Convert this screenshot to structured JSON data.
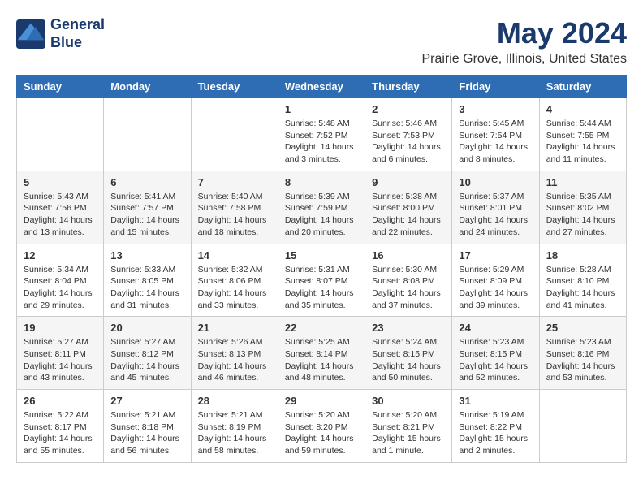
{
  "logo": {
    "line1": "General",
    "line2": "Blue"
  },
  "title": "May 2024",
  "location": "Prairie Grove, Illinois, United States",
  "days_of_week": [
    "Sunday",
    "Monday",
    "Tuesday",
    "Wednesday",
    "Thursday",
    "Friday",
    "Saturday"
  ],
  "weeks": [
    [
      {
        "day": "",
        "text": ""
      },
      {
        "day": "",
        "text": ""
      },
      {
        "day": "",
        "text": ""
      },
      {
        "day": "1",
        "text": "Sunrise: 5:48 AM\nSunset: 7:52 PM\nDaylight: 14 hours\nand 3 minutes."
      },
      {
        "day": "2",
        "text": "Sunrise: 5:46 AM\nSunset: 7:53 PM\nDaylight: 14 hours\nand 6 minutes."
      },
      {
        "day": "3",
        "text": "Sunrise: 5:45 AM\nSunset: 7:54 PM\nDaylight: 14 hours\nand 8 minutes."
      },
      {
        "day": "4",
        "text": "Sunrise: 5:44 AM\nSunset: 7:55 PM\nDaylight: 14 hours\nand 11 minutes."
      }
    ],
    [
      {
        "day": "5",
        "text": "Sunrise: 5:43 AM\nSunset: 7:56 PM\nDaylight: 14 hours\nand 13 minutes."
      },
      {
        "day": "6",
        "text": "Sunrise: 5:41 AM\nSunset: 7:57 PM\nDaylight: 14 hours\nand 15 minutes."
      },
      {
        "day": "7",
        "text": "Sunrise: 5:40 AM\nSunset: 7:58 PM\nDaylight: 14 hours\nand 18 minutes."
      },
      {
        "day": "8",
        "text": "Sunrise: 5:39 AM\nSunset: 7:59 PM\nDaylight: 14 hours\nand 20 minutes."
      },
      {
        "day": "9",
        "text": "Sunrise: 5:38 AM\nSunset: 8:00 PM\nDaylight: 14 hours\nand 22 minutes."
      },
      {
        "day": "10",
        "text": "Sunrise: 5:37 AM\nSunset: 8:01 PM\nDaylight: 14 hours\nand 24 minutes."
      },
      {
        "day": "11",
        "text": "Sunrise: 5:35 AM\nSunset: 8:02 PM\nDaylight: 14 hours\nand 27 minutes."
      }
    ],
    [
      {
        "day": "12",
        "text": "Sunrise: 5:34 AM\nSunset: 8:04 PM\nDaylight: 14 hours\nand 29 minutes."
      },
      {
        "day": "13",
        "text": "Sunrise: 5:33 AM\nSunset: 8:05 PM\nDaylight: 14 hours\nand 31 minutes."
      },
      {
        "day": "14",
        "text": "Sunrise: 5:32 AM\nSunset: 8:06 PM\nDaylight: 14 hours\nand 33 minutes."
      },
      {
        "day": "15",
        "text": "Sunrise: 5:31 AM\nSunset: 8:07 PM\nDaylight: 14 hours\nand 35 minutes."
      },
      {
        "day": "16",
        "text": "Sunrise: 5:30 AM\nSunset: 8:08 PM\nDaylight: 14 hours\nand 37 minutes."
      },
      {
        "day": "17",
        "text": "Sunrise: 5:29 AM\nSunset: 8:09 PM\nDaylight: 14 hours\nand 39 minutes."
      },
      {
        "day": "18",
        "text": "Sunrise: 5:28 AM\nSunset: 8:10 PM\nDaylight: 14 hours\nand 41 minutes."
      }
    ],
    [
      {
        "day": "19",
        "text": "Sunrise: 5:27 AM\nSunset: 8:11 PM\nDaylight: 14 hours\nand 43 minutes."
      },
      {
        "day": "20",
        "text": "Sunrise: 5:27 AM\nSunset: 8:12 PM\nDaylight: 14 hours\nand 45 minutes."
      },
      {
        "day": "21",
        "text": "Sunrise: 5:26 AM\nSunset: 8:13 PM\nDaylight: 14 hours\nand 46 minutes."
      },
      {
        "day": "22",
        "text": "Sunrise: 5:25 AM\nSunset: 8:14 PM\nDaylight: 14 hours\nand 48 minutes."
      },
      {
        "day": "23",
        "text": "Sunrise: 5:24 AM\nSunset: 8:15 PM\nDaylight: 14 hours\nand 50 minutes."
      },
      {
        "day": "24",
        "text": "Sunrise: 5:23 AM\nSunset: 8:15 PM\nDaylight: 14 hours\nand 52 minutes."
      },
      {
        "day": "25",
        "text": "Sunrise: 5:23 AM\nSunset: 8:16 PM\nDaylight: 14 hours\nand 53 minutes."
      }
    ],
    [
      {
        "day": "26",
        "text": "Sunrise: 5:22 AM\nSunset: 8:17 PM\nDaylight: 14 hours\nand 55 minutes."
      },
      {
        "day": "27",
        "text": "Sunrise: 5:21 AM\nSunset: 8:18 PM\nDaylight: 14 hours\nand 56 minutes."
      },
      {
        "day": "28",
        "text": "Sunrise: 5:21 AM\nSunset: 8:19 PM\nDaylight: 14 hours\nand 58 minutes."
      },
      {
        "day": "29",
        "text": "Sunrise: 5:20 AM\nSunset: 8:20 PM\nDaylight: 14 hours\nand 59 minutes."
      },
      {
        "day": "30",
        "text": "Sunrise: 5:20 AM\nSunset: 8:21 PM\nDaylight: 15 hours\nand 1 minute."
      },
      {
        "day": "31",
        "text": "Sunrise: 5:19 AM\nSunset: 8:22 PM\nDaylight: 15 hours\nand 2 minutes."
      },
      {
        "day": "",
        "text": ""
      }
    ]
  ]
}
